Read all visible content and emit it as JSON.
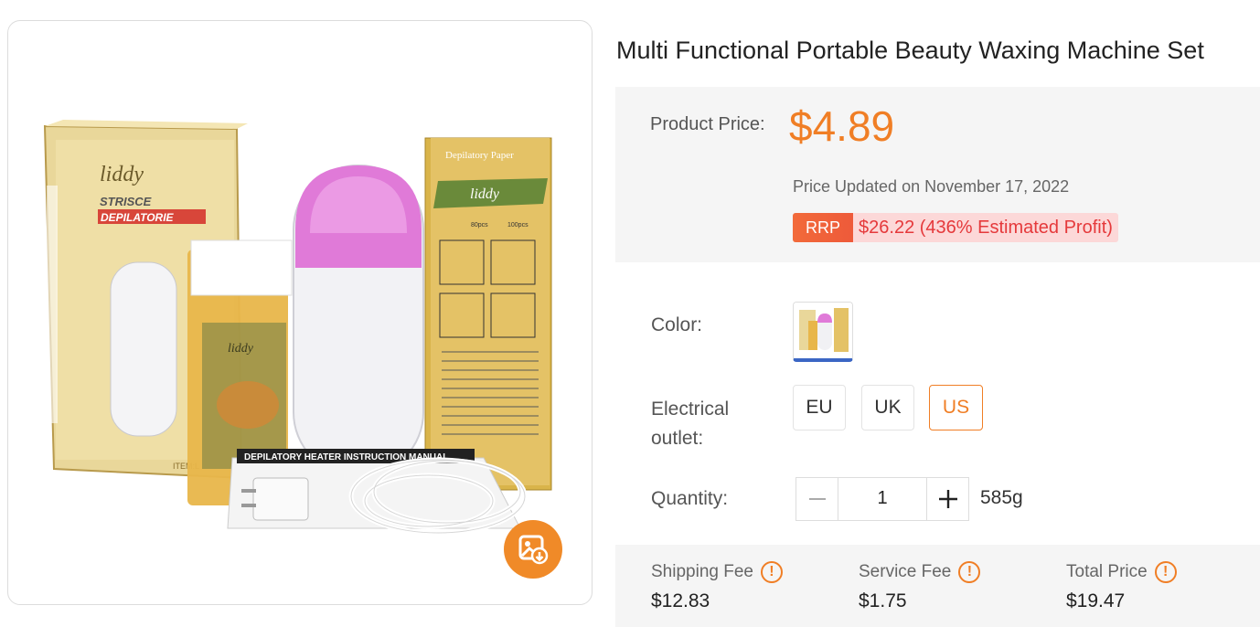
{
  "product": {
    "title": "Multi Functional Portable Beauty Waxing Machine Set",
    "image_icon": "image-search-icon"
  },
  "product_image_text": {
    "box_brand": "liddy",
    "box_line1": "STRISCE",
    "box_line2": "DEPILATORIE",
    "box_item": "ITEM:L",
    "paper_title": "Depilatory Paper",
    "paper_brand": "liddy",
    "paper_opt1": "80pcs",
    "paper_opt2": "100pcs",
    "cartridge_brand": "liddy",
    "manual_text": "DEPILATORY HEATER INSTRUCTION MANUAL"
  },
  "pricing": {
    "label": "Product Price:",
    "price": "$4.89",
    "updated": "Price Updated on November 17, 2022",
    "rrp_badge": "RRP",
    "rrp_text": "$26.22 (436% Estimated Profit)",
    "accent_color": "#f07e25"
  },
  "options": {
    "color_label": "Color:",
    "outlet_label_line1": "Electrical",
    "outlet_label_line2": "outlet:",
    "outlets": [
      "EU",
      "UK",
      "US"
    ],
    "selected_outlet": "US",
    "quantity_label": "Quantity:",
    "quantity_value": "1",
    "weight": "585g"
  },
  "fees": {
    "shipping_label": "Shipping Fee",
    "shipping_value": "$12.83",
    "service_label": "Service Fee",
    "service_value": "$1.75",
    "total_label": "Total Price",
    "total_value": "$19.47",
    "info_glyph": "!"
  }
}
